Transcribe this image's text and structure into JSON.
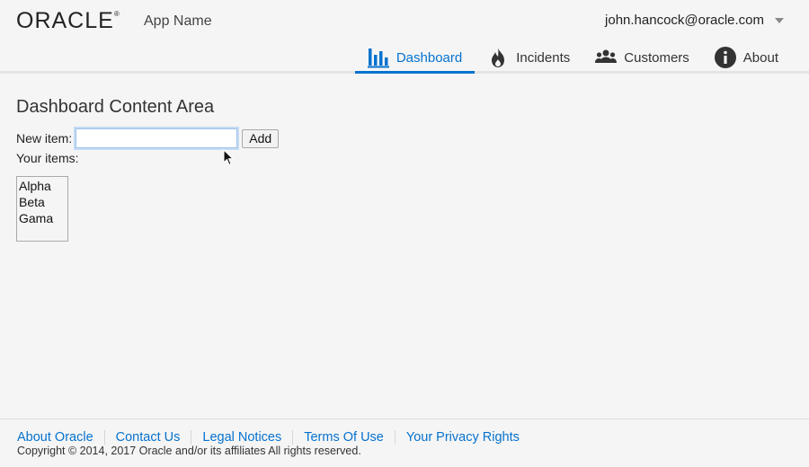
{
  "header": {
    "logo_text": "ORACLE",
    "logo_mark": "®",
    "app_name": "App Name",
    "user_email": "john.hancock@oracle.com",
    "user_menu_icon": "caret-down-icon"
  },
  "nav": {
    "items": [
      {
        "label": "Dashboard",
        "icon": "bar-chart-icon",
        "active": true
      },
      {
        "label": "Incidents",
        "icon": "flame-icon",
        "active": false
      },
      {
        "label": "Customers",
        "icon": "people-icon",
        "active": false
      },
      {
        "label": "About",
        "icon": "info-icon",
        "active": false
      }
    ],
    "accent_color": "#0572ce"
  },
  "main": {
    "title": "Dashboard Content Area",
    "new_item_label": "New item:",
    "new_item_value": "",
    "add_button_label": "Add",
    "items_label": "Your items:",
    "items": [
      "Alpha",
      "Beta",
      "Gama"
    ]
  },
  "footer": {
    "links": [
      "About Oracle",
      "Contact Us",
      "Legal Notices",
      "Terms Of Use",
      "Your Privacy Rights"
    ],
    "copyright": "Copyright © 2014, 2017 Oracle and/or its affiliates All rights reserved."
  }
}
